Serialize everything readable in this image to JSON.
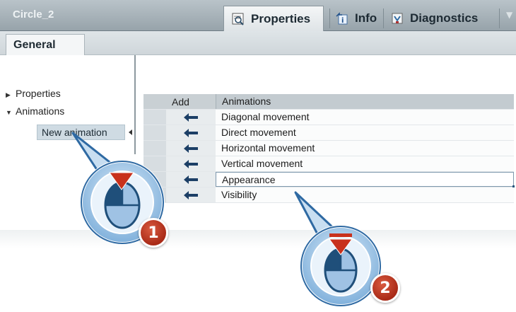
{
  "window": {
    "title": "Circle_2"
  },
  "tabs": [
    {
      "label": "Properties",
      "icon": "properties-icon",
      "active": true
    },
    {
      "label": "Info",
      "icon": "info-icon",
      "active": false
    },
    {
      "label": "Diagnostics",
      "icon": "diagnostics-icon",
      "active": false
    }
  ],
  "general_tab": {
    "label": "General"
  },
  "tree": {
    "items": [
      {
        "label": "Properties",
        "expanded": false
      },
      {
        "label": "Animations",
        "expanded": true
      }
    ],
    "selected_child": "New animation"
  },
  "table": {
    "headers": {
      "add": "Add",
      "animations": "Animations"
    },
    "rows": [
      "Diagonal movement",
      "Direct movement",
      "Horizontal movement",
      "Vertical movement",
      "Appearance",
      "Visibility"
    ],
    "selected_row": "Appearance"
  },
  "callouts": [
    {
      "number": "1",
      "action": "click"
    },
    {
      "number": "2",
      "action": "double-click"
    }
  ],
  "colors": {
    "accent": "#1f4f7a",
    "badge": "#b4321f",
    "mouse_fill": "#9fc2e4"
  }
}
